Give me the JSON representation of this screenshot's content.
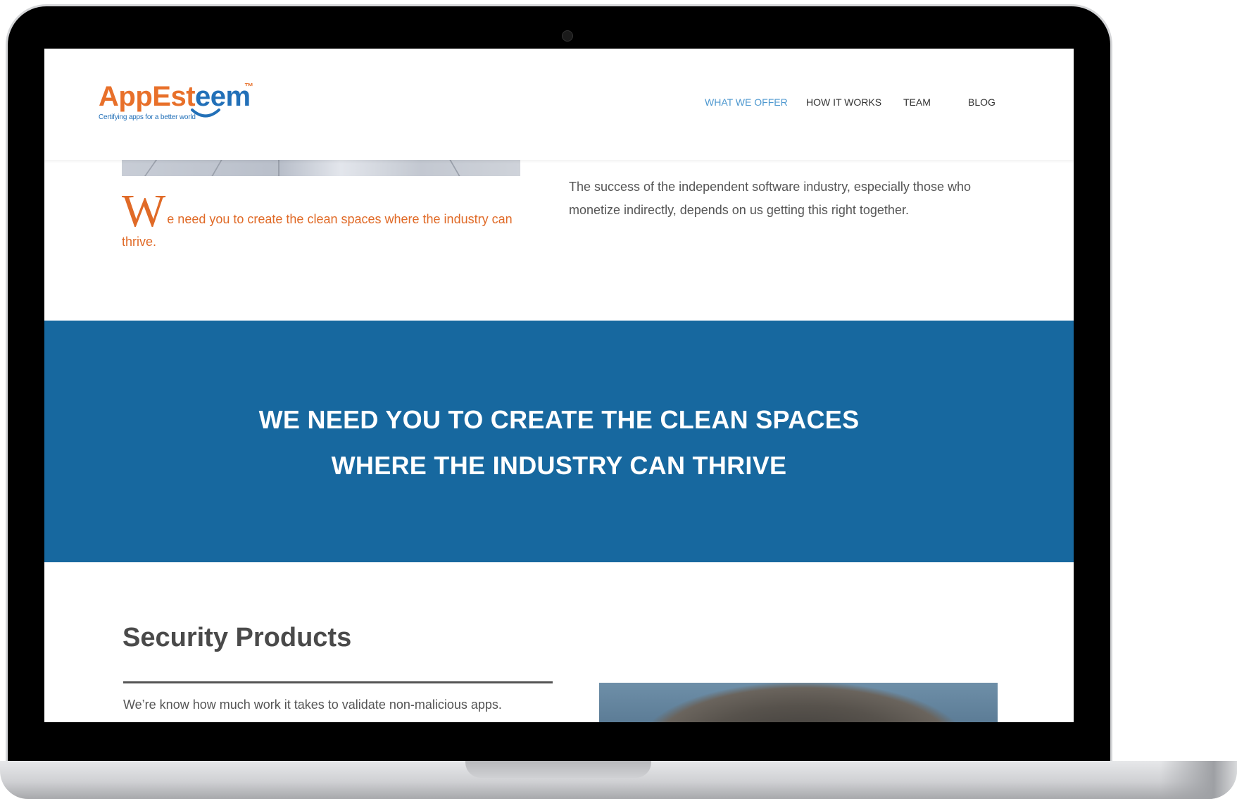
{
  "brand": {
    "logo_app": "App",
    "logo_esteem_a": "Est",
    "logo_esteem_b": "eem",
    "logo_tm": "™",
    "tagline": "Certifying apps for a better world",
    "colors": {
      "orange": "#e8702a",
      "blue": "#2270b8",
      "nav_active": "#4c97cf",
      "banner": "#17689f"
    }
  },
  "nav": {
    "items": [
      {
        "label": "WHAT WE OFFER",
        "active": true
      },
      {
        "label": "HOW IT WORKS",
        "active": false
      },
      {
        "label": "TEAM",
        "active": false
      },
      {
        "label": "BLOG",
        "active": false
      }
    ]
  },
  "intro": {
    "dropcap_letter": "W",
    "dropcap_rest": "e need you to create the clean spaces where the industry can thrive.",
    "right_text": "The success of the independent software industry, especially those who monetize indirectly, depends on us getting this right together."
  },
  "banner": {
    "line1": "WE NEED YOU TO CREATE THE CLEAN SPACES",
    "line2": "WHERE THE INDUSTRY CAN THRIVE"
  },
  "security": {
    "title": "Security Products",
    "text": "We’re know how much work it takes to validate non-malicious apps."
  }
}
